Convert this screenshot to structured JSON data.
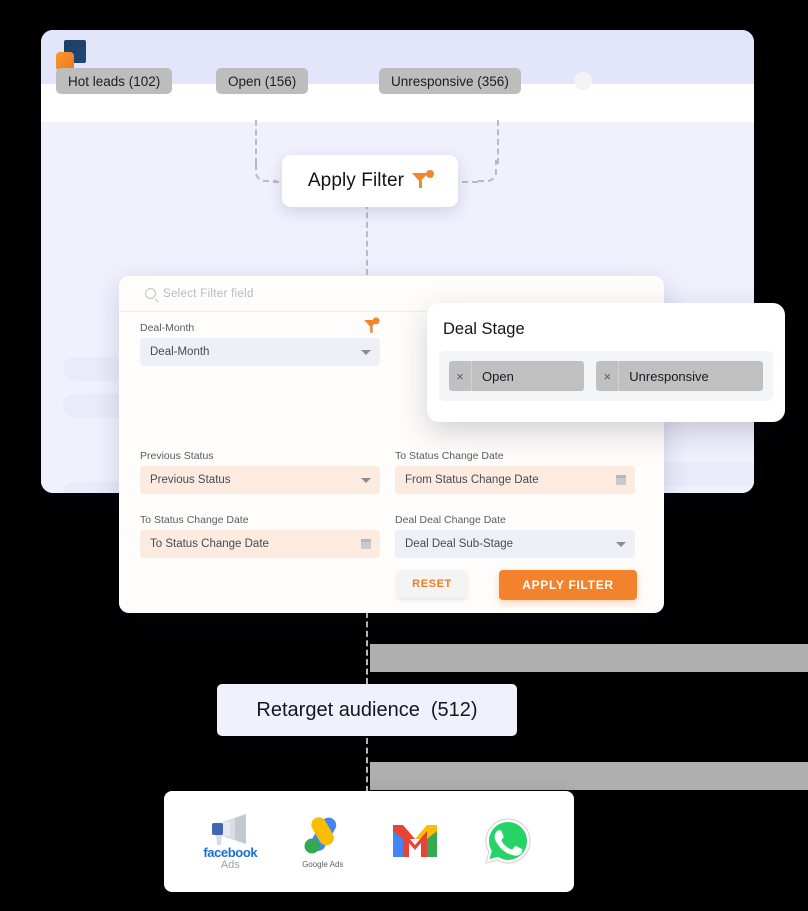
{
  "app": {
    "logo_name": "brand-logo",
    "tabs": [
      {
        "label": "Hot leads (102)"
      },
      {
        "label": "Open (156)"
      },
      {
        "label": "Unresponsive (356)"
      }
    ]
  },
  "apply_badge": {
    "label": "Apply Filter",
    "icon": "funnel-plus-icon"
  },
  "filter_panel": {
    "search_placeholder": "Select Filter field",
    "search_icon": "search-icon",
    "funnel_icon": "funnel-plus-icon",
    "fields": [
      {
        "label": "Deal-Month",
        "value": "Deal-Month",
        "control": "dropdown"
      },
      {
        "label": "Previous Status",
        "value": "Previous Status",
        "control": "dropdown"
      },
      {
        "label": "To Status Change Date",
        "value": "From Status Change Date",
        "control": "date"
      },
      {
        "label": "To Status Change Date",
        "value": "To Status Change Date",
        "control": "date"
      },
      {
        "label": "Deal Deal Change Date",
        "value": "Deal Deal Sub-Stage",
        "control": "dropdown"
      }
    ],
    "reset_label": "RESET",
    "apply_label": "APPLY FILTER"
  },
  "deal_stage": {
    "title": "Deal Stage",
    "chips": [
      {
        "label": "Open",
        "remove": "×"
      },
      {
        "label": "Unresponsive",
        "remove": "×"
      }
    ]
  },
  "retarget": {
    "label": "Retarget audience",
    "count": "(512)"
  },
  "channels": [
    {
      "name": "facebook-ads",
      "line1": "facebook",
      "line2": "Ads"
    },
    {
      "name": "google-ads",
      "caption": "Google Ads"
    },
    {
      "name": "gmail",
      "caption": ""
    },
    {
      "name": "whatsapp",
      "caption": ""
    }
  ],
  "colors": {
    "accent_orange": "#f2822c",
    "header_lavender": "#e3e6fb",
    "body_lavender": "#f0f1fd",
    "tab_gray": "#bdbdbd",
    "peach_field": "#fdebe0"
  }
}
